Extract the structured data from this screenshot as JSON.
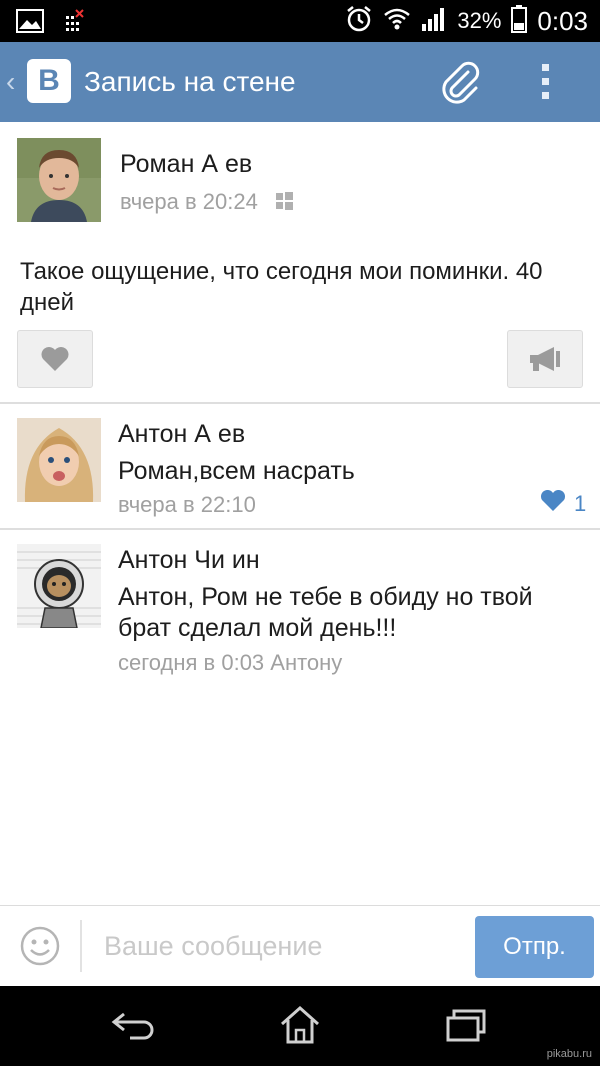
{
  "status_bar": {
    "battery_percent": "32%",
    "time": "0:03",
    "icons": [
      "image-icon",
      "sim-error-icon",
      "alarm-icon",
      "wifi-icon",
      "signal-icon",
      "battery-icon"
    ]
  },
  "header": {
    "title": "Запись на стене",
    "logo_letter": "В",
    "icons": [
      "back-chevron-icon",
      "vk-logo",
      "paperclip-icon",
      "more-vertical-icon"
    ]
  },
  "post": {
    "author": "Роман А          ев",
    "time": "вчера в 20:24",
    "text": "Такое ощущение, что сегодня мои поминки. 40 дней",
    "icons": [
      "windows-icon",
      "heart-icon",
      "megaphone-icon"
    ]
  },
  "comments": [
    {
      "author": "Антон А          ев",
      "text": "Роман,всем насрать",
      "time": "вчера в 22:10",
      "likes": "1"
    },
    {
      "author": "Антон Чи           ин",
      "text": "Антон, Ром не тебе в обиду но твой брат сделал мой день!!!",
      "time": "сегодня в 0:03 Антону"
    }
  ],
  "composer": {
    "placeholder": "Ваше сообщение",
    "value": "",
    "send_label": "Отпр."
  },
  "navigation": {
    "icons": [
      "nav-back-icon",
      "nav-home-icon",
      "nav-recents-icon"
    ]
  },
  "watermark": "pikabu.ru",
  "colors": {
    "header_bg": "#5b86b5",
    "send_button_bg": "#6d9fd6",
    "like_blue": "#4a86c5",
    "secondary_text": "#a0a0a0"
  }
}
